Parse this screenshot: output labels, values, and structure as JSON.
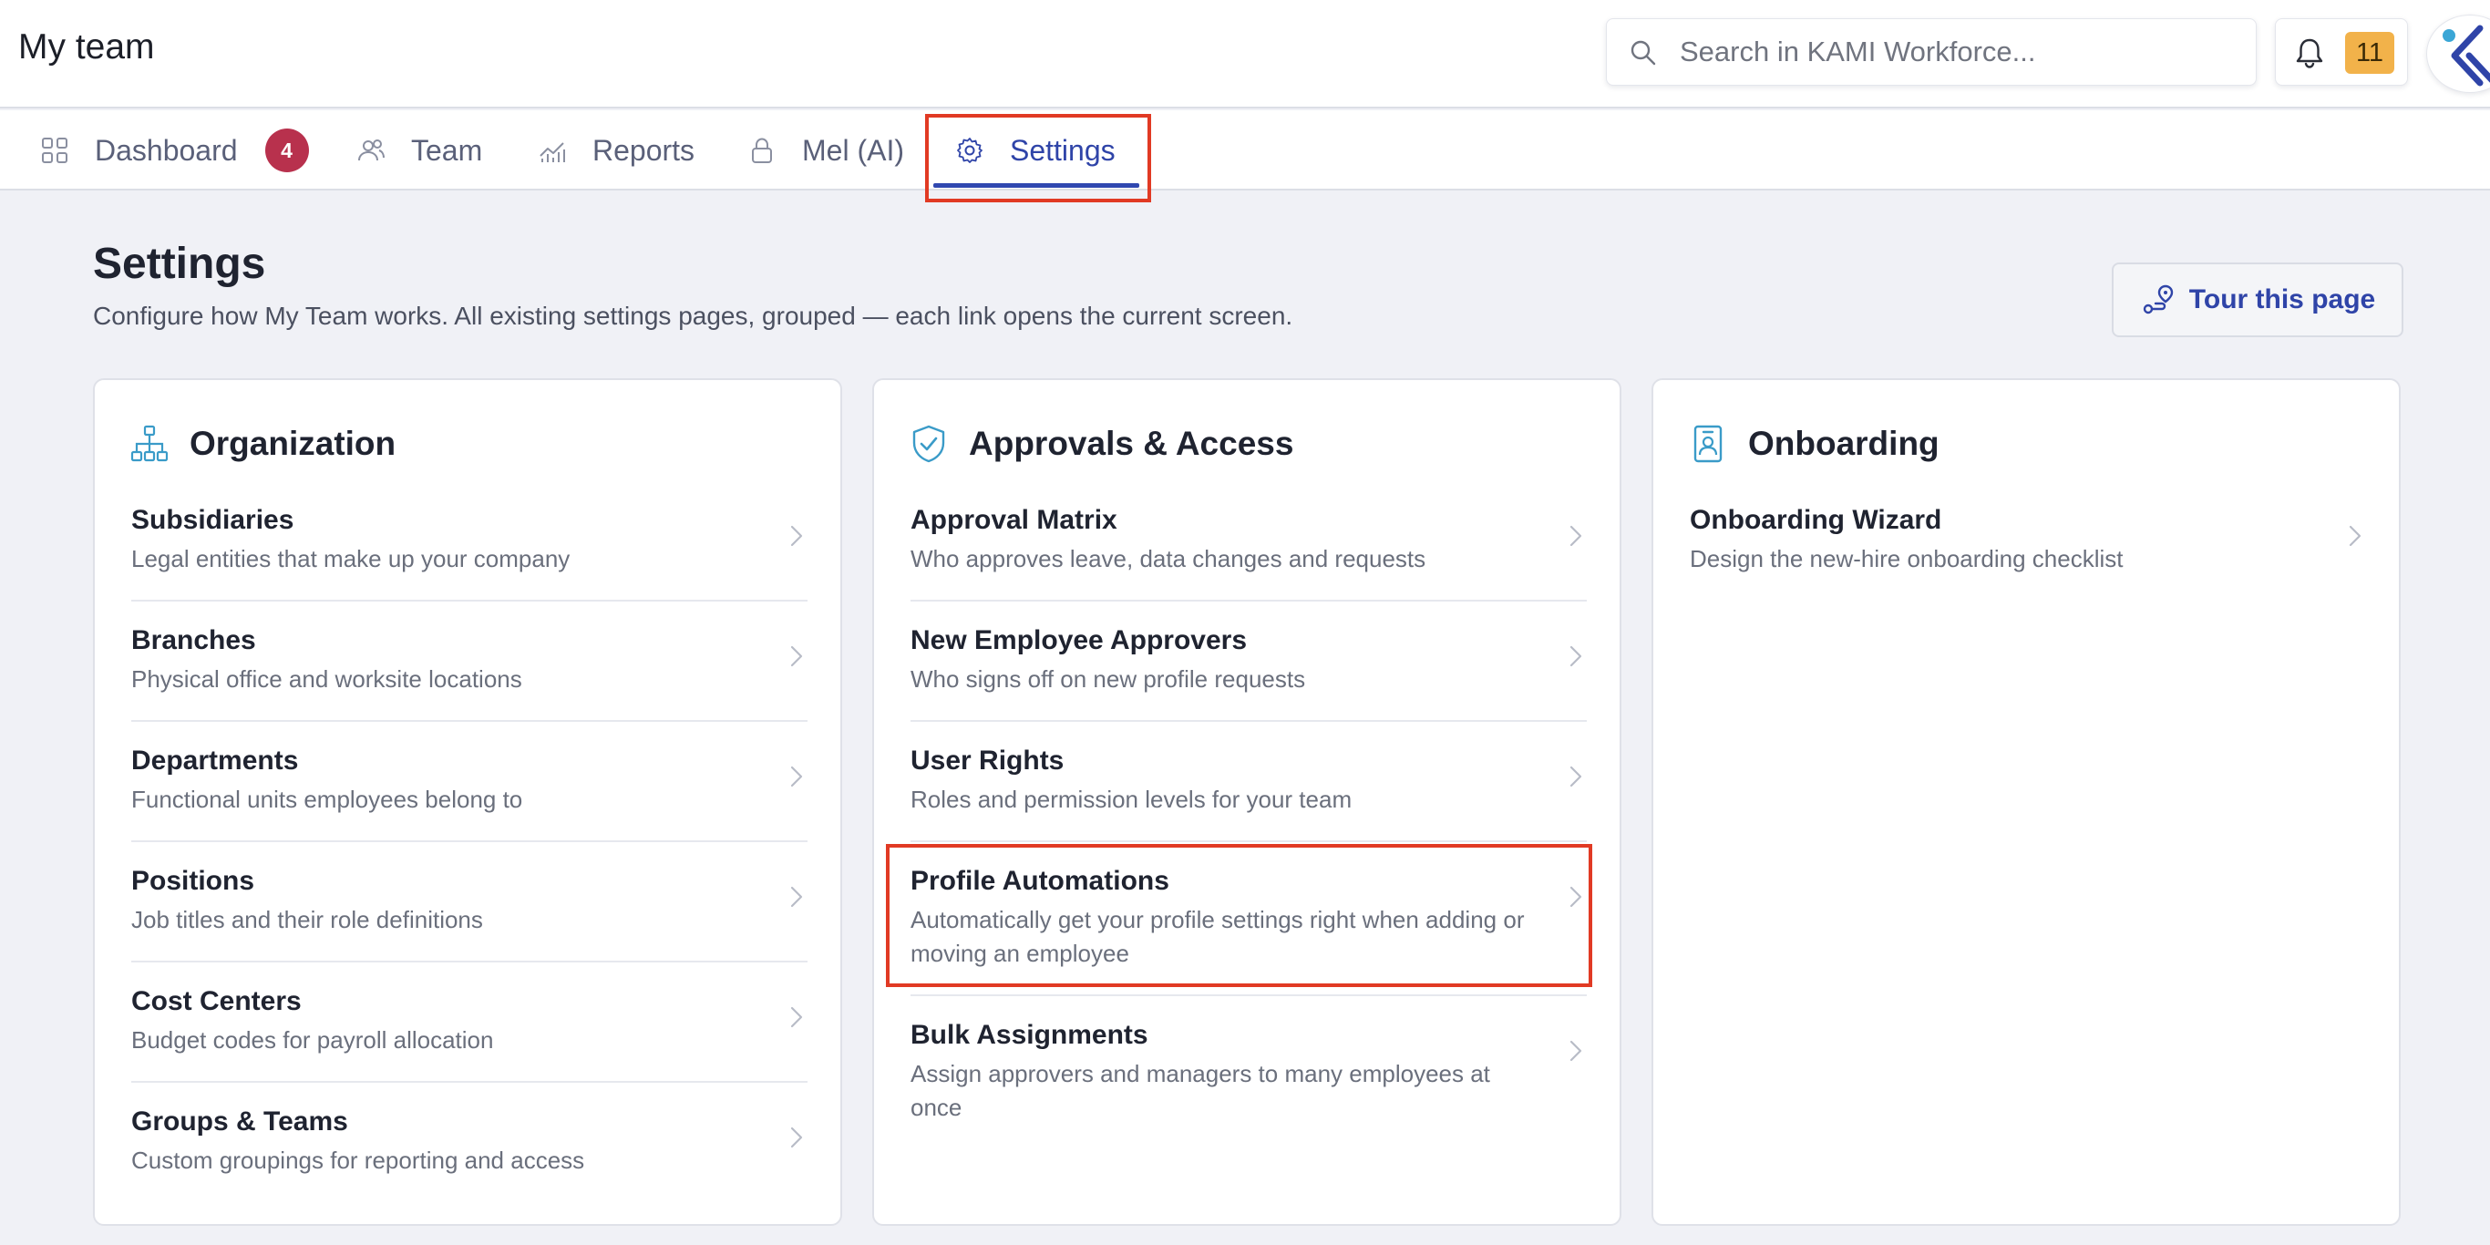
{
  "app": {
    "title": "My team"
  },
  "search": {
    "placeholder": "Search in KAMI Workforce..."
  },
  "notifications": {
    "count": "11"
  },
  "tabs": [
    {
      "label": "Dashboard",
      "icon": "grid-icon",
      "badge": "4"
    },
    {
      "label": "Team",
      "icon": "users-icon"
    },
    {
      "label": "Reports",
      "icon": "chart-icon"
    },
    {
      "label": "Mel (AI)",
      "icon": "lock-icon"
    },
    {
      "label": "Settings",
      "icon": "gear-icon",
      "active": true
    }
  ],
  "page": {
    "title": "Settings",
    "description": "Configure how My Team works. All existing settings pages, grouped — each link opens the current screen.",
    "tour_button": "Tour this page"
  },
  "cards": [
    {
      "title": "Organization",
      "icon": "org-chart-icon",
      "items": [
        {
          "title": "Subsidiaries",
          "subtitle": "Legal entities that make up your company"
        },
        {
          "title": "Branches",
          "subtitle": "Physical office and worksite locations"
        },
        {
          "title": "Departments",
          "subtitle": "Functional units employees belong to"
        },
        {
          "title": "Positions",
          "subtitle": "Job titles and their role definitions"
        },
        {
          "title": "Cost Centers",
          "subtitle": "Budget codes for payroll allocation"
        },
        {
          "title": "Groups & Teams",
          "subtitle": "Custom groupings for reporting and access"
        }
      ]
    },
    {
      "title": "Approvals & Access",
      "icon": "shield-check-icon",
      "items": [
        {
          "title": "Approval Matrix",
          "subtitle": "Who approves leave, data changes and requests"
        },
        {
          "title": "New Employee Approvers",
          "subtitle": "Who signs off on new profile requests"
        },
        {
          "title": "User Rights",
          "subtitle": "Roles and permission levels for your team"
        },
        {
          "title": "Profile Automations",
          "subtitle": "Automatically get your profile settings right when adding or moving an employee"
        },
        {
          "title": "Bulk Assignments",
          "subtitle": "Assign approvers and managers to many employees at once"
        }
      ]
    },
    {
      "title": "Onboarding",
      "icon": "id-badge-icon",
      "items": [
        {
          "title": "Onboarding Wizard",
          "subtitle": "Design the new-hire onboarding checklist"
        }
      ]
    }
  ],
  "colors": {
    "accent": "#2f44a8",
    "badge": "#b8314d",
    "notification": "#f2b24a",
    "highlight": "#e13a24",
    "background": "#f0f1f6"
  }
}
